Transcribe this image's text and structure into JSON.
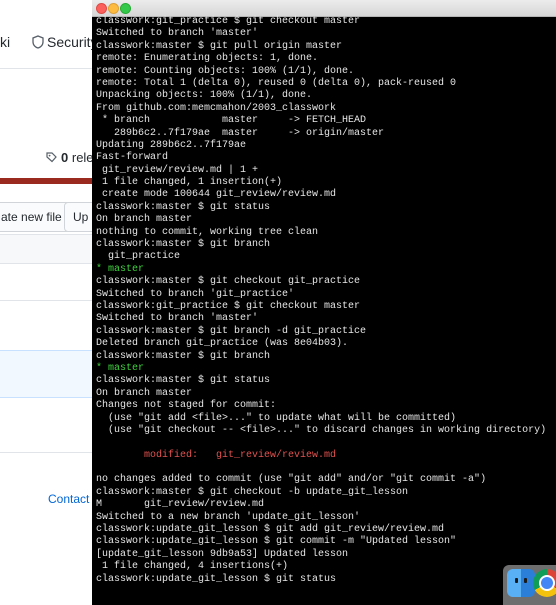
{
  "background_page": {
    "tabs": [
      "ki",
      "Security"
    ],
    "releases_count": "0",
    "releases_label": "rele",
    "buttons": [
      "ate new file",
      "Up"
    ],
    "contact_link": "Contact"
  },
  "terminal": {
    "lines": [
      {
        "text": "classwork:git_practice $ git checkout master",
        "style": ""
      },
      {
        "text": "Switched to branch 'master'",
        "style": ""
      },
      {
        "text": "classwork:master $ git pull origin master",
        "style": ""
      },
      {
        "text": "remote: Enumerating objects: 1, done.",
        "style": ""
      },
      {
        "text": "remote: Counting objects: 100% (1/1), done.",
        "style": ""
      },
      {
        "text": "remote: Total 1 (delta 0), reused 0 (delta 0), pack-reused 0",
        "style": ""
      },
      {
        "text": "Unpacking objects: 100% (1/1), done.",
        "style": ""
      },
      {
        "text": "From github.com:memcmahon/2003_classwork",
        "style": ""
      },
      {
        "text": " * branch            master     -> FETCH_HEAD",
        "style": ""
      },
      {
        "text": "   289b6c2..7f179ae  master     -> origin/master",
        "style": ""
      },
      {
        "text": "Updating 289b6c2..7f179ae",
        "style": ""
      },
      {
        "text": "Fast-forward",
        "style": ""
      },
      {
        "text": " git_review/review.md | 1 +",
        "style": ""
      },
      {
        "text": " 1 file changed, 1 insertion(+)",
        "style": ""
      },
      {
        "text": " create mode 100644 git_review/review.md",
        "style": ""
      },
      {
        "text": "classwork:master $ git status",
        "style": ""
      },
      {
        "text": "On branch master",
        "style": ""
      },
      {
        "text": "nothing to commit, working tree clean",
        "style": ""
      },
      {
        "text": "classwork:master $ git branch",
        "style": ""
      },
      {
        "text": "  git_practice",
        "style": ""
      },
      {
        "text": "* master",
        "style": "green"
      },
      {
        "text": "classwork:master $ git checkout git_practice",
        "style": ""
      },
      {
        "text": "Switched to branch 'git_practice'",
        "style": ""
      },
      {
        "text": "classwork:git_practice $ git checkout master",
        "style": ""
      },
      {
        "text": "Switched to branch 'master'",
        "style": ""
      },
      {
        "text": "classwork:master $ git branch -d git_practice",
        "style": ""
      },
      {
        "text": "Deleted branch git_practice (was 8e04b03).",
        "style": ""
      },
      {
        "text": "classwork:master $ git branch",
        "style": ""
      },
      {
        "text": "* master",
        "style": "green"
      },
      {
        "text": "classwork:master $ git status",
        "style": ""
      },
      {
        "text": "On branch master",
        "style": ""
      },
      {
        "text": "Changes not staged for commit:",
        "style": ""
      },
      {
        "text": "  (use \"git add <file>...\" to update what will be committed)",
        "style": ""
      },
      {
        "text": "  (use \"git checkout -- <file>...\" to discard changes in working directory)",
        "style": ""
      },
      {
        "text": "",
        "style": "blank"
      },
      {
        "text": "\tmodified:   git_review/review.md",
        "style": "red"
      },
      {
        "text": "",
        "style": "blank"
      },
      {
        "text": "no changes added to commit (use \"git add\" and/or \"git commit -a\")",
        "style": ""
      },
      {
        "text": "classwork:master $ git checkout -b update_git_lesson",
        "style": ""
      },
      {
        "text": "M\tgit_review/review.md",
        "style": ""
      },
      {
        "text": "Switched to a new branch 'update_git_lesson'",
        "style": ""
      },
      {
        "text": "classwork:update_git_lesson $ git add git_review/review.md",
        "style": ""
      },
      {
        "text": "classwork:update_git_lesson $ git commit -m \"Updated lesson\"",
        "style": ""
      },
      {
        "text": "[update_git_lesson 9db9a53] Updated lesson",
        "style": ""
      },
      {
        "text": " 1 file changed, 4 insertions(+)",
        "style": ""
      },
      {
        "text": "classwork:update_git_lesson $ git status",
        "style": ""
      }
    ]
  },
  "dock": {
    "icons": [
      "finder-icon",
      "chrome-icon"
    ]
  },
  "colors": {
    "terminal_bg": "#000000",
    "terminal_text": "#e6e6e6",
    "branch_green": "#3fd23f",
    "modified_red": "#e0524f",
    "link_blue": "#0366d6"
  }
}
